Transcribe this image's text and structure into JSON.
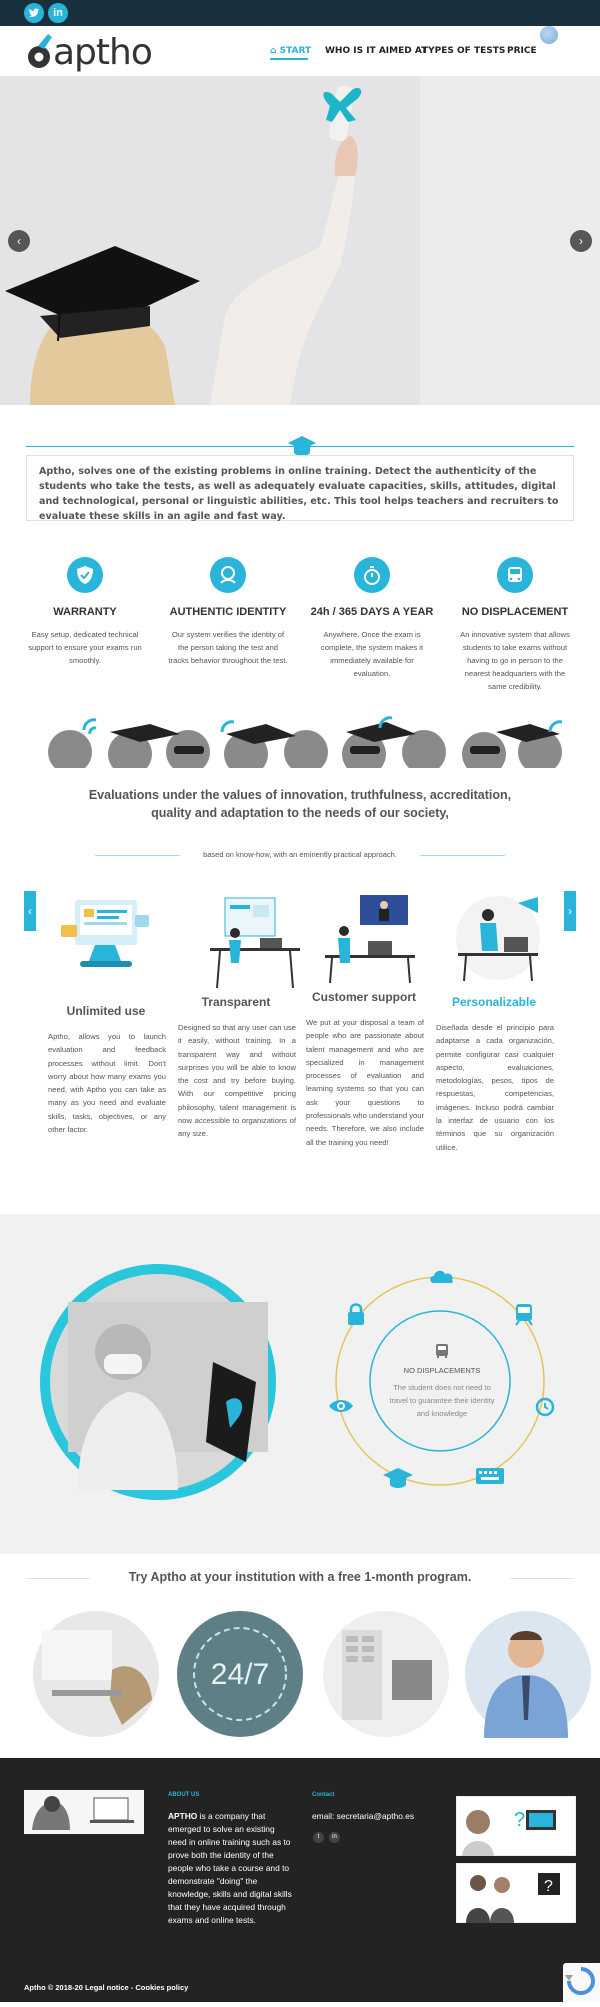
{
  "header": {
    "logo_text": "aptho",
    "nav": [
      "START",
      "WHO IS IT AIMED AT",
      "TYPES OF TESTS",
      "PRICE"
    ]
  },
  "intro": {
    "text": "Aptho, solves one of the existing problems in online training. Detect the authenticity of the students who take the tests, as well as adequately evaluate capacities, skills, attitudes, digital and technological, personal or linguistic abilities, etc. This tool helps teachers and recruiters to evaluate these skills in an agile and fast way."
  },
  "features": [
    {
      "title": "WARRANTY",
      "text": "Easy setup, dedicated technical support to ensure your exams run smoothly.",
      "icon": "shield-icon"
    },
    {
      "title": "AUTHENTIC IDENTITY",
      "text": "Our system verifies the identity of the person taking the test and tracks behavior throughout the test.",
      "icon": "fingerprint-icon"
    },
    {
      "title": "24h / 365 DAYS A YEAR",
      "text": "Anywhere. Once the exam is complete, the system makes it immediately available for evaluation.",
      "icon": "stopwatch-icon"
    },
    {
      "title": "NO DISPLACEMENT",
      "text": "An innovative system that allows students to take exams without having to go in person to the nearest headquarters with the same credibility.",
      "icon": "bus-icon"
    }
  ],
  "values": {
    "title": "Evaluations under the values of innovation, truthfulness, accreditation, quality and adaptation to the needs of our society,",
    "subtitle": "based on know-how, with an eminently practical approach."
  },
  "cards": [
    {
      "title": "Unlimited use",
      "text": "Aptho, allows you to launch evaluation and feedback processes without limit. Don't worry about how many exams you need, with Aptho you can take as many as you need and evaluate skills, tasks, objectives, or any other factor."
    },
    {
      "title": "Transparent",
      "text": "Designed so that any user can use it easily, without training. In a transparent way and without surprises you will be able to know the cost and try before buying. With our competitive pricing philosophy, talent management is now accessible to organizations of any size."
    },
    {
      "title": "Customer support",
      "text": "We put at your disposal a team of people who are passionate about talent management and who are specialized in management processes of evaluation and learning systems so that you can ask your questions to professionals who understand your needs. Therefore, we also include all the training you need!"
    },
    {
      "title": "Personalizable",
      "text": "Diseñada desde el principio para adaptarse a cada organización, permite configurar casi cualquier aspecto, evaluaciones, metodologías, pesos, tipos de respuestas, competencias, imágenes. Incluso podrá cambiar la interfaz de usuario con los términos que su organización utilice."
    }
  ],
  "ring": {
    "title": "NO DISPLACEMENTS",
    "text": "The student does not need to travel to guarantee their identity and knowledge",
    "icons": [
      "cloud-icon",
      "train-icon",
      "alarm-clock-icon",
      "keyboard-icon",
      "graduation-cap-icon",
      "eye-icon",
      "lock-icon"
    ]
  },
  "trial": {
    "title": "Try Aptho at your institution with a free 1-month program.",
    "clock_text": "24/7"
  },
  "footer": {
    "about_heading": "ABOUT US",
    "about_brand": "APTHO",
    "about_text": " is a company that emerged to solve an existing need in online training such as to prove both the identity of the people who take a course and to demonstrate \"doing\" the knowledge, skills and digital skills that they have acquired through exams and online tests.",
    "contact_heading": "Contact",
    "email": "email: secretaria@aptho.es",
    "copyright": "Aptho © 2018-20 Legal notice - Cookies policy"
  },
  "colors": {
    "accent": "#29b4d9",
    "dark_bar": "#18303d",
    "footer": "#232323"
  }
}
